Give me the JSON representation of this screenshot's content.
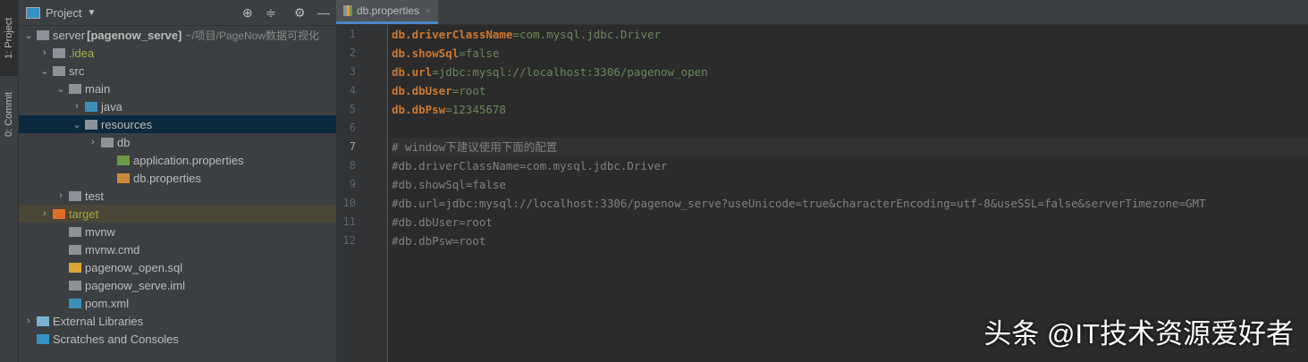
{
  "strip": {
    "tab1": "1: Project",
    "tab2": "0: Commit"
  },
  "panel": {
    "title": "Project"
  },
  "tree": [
    {
      "label": "server",
      "bold": "[pagenow_serve]",
      "hint": "~/项目/PageNow数据可视化",
      "depth": 0,
      "arrow": "⌄",
      "icon": "module",
      "color": "#bbbbbb"
    },
    {
      "label": ".idea",
      "depth": 1,
      "arrow": "›",
      "icon": "folder",
      "color": "#a7b14a"
    },
    {
      "label": "src",
      "depth": 1,
      "arrow": "⌄",
      "icon": "folder",
      "color": "#bbbbbb"
    },
    {
      "label": "main",
      "depth": 2,
      "arrow": "⌄",
      "icon": "folder",
      "color": "#bbbbbb"
    },
    {
      "label": "java",
      "depth": 3,
      "arrow": "›",
      "icon": "source-folder",
      "color": "#bbbbbb"
    },
    {
      "label": "resources",
      "depth": 3,
      "arrow": "⌄",
      "icon": "resources-folder",
      "color": "#bbbbbb",
      "selected": true
    },
    {
      "label": "db",
      "depth": 4,
      "arrow": "›",
      "icon": "folder",
      "color": "#bbbbbb"
    },
    {
      "label": "application.properties",
      "depth": 5,
      "arrow": "",
      "icon": "spring",
      "color": "#bbbbbb"
    },
    {
      "label": "db.properties",
      "depth": 5,
      "arrow": "",
      "icon": "properties",
      "color": "#bbbbbb"
    },
    {
      "label": "test",
      "depth": 2,
      "arrow": "›",
      "icon": "folder",
      "color": "#bbbbbb"
    },
    {
      "label": "target",
      "depth": 1,
      "arrow": "›",
      "icon": "excluded-folder",
      "color": "#a7a53a",
      "target": true
    },
    {
      "label": "mvnw",
      "depth": 2,
      "arrow": "",
      "icon": "shell",
      "color": "#bbbbbb"
    },
    {
      "label": "mvnw.cmd",
      "depth": 2,
      "arrow": "",
      "icon": "text",
      "color": "#bbbbbb"
    },
    {
      "label": "pagenow_open.sql",
      "depth": 2,
      "arrow": "",
      "icon": "sql",
      "color": "#bbbbbb"
    },
    {
      "label": "pagenow_serve.iml",
      "depth": 2,
      "arrow": "",
      "icon": "iml",
      "color": "#bbbbbb"
    },
    {
      "label": "pom.xml",
      "depth": 2,
      "arrow": "",
      "icon": "maven",
      "color": "#bbbbbb"
    },
    {
      "label": "External Libraries",
      "depth": 0,
      "arrow": "›",
      "icon": "libraries",
      "color": "#bbbbbb"
    },
    {
      "label": "Scratches and Consoles",
      "depth": 0,
      "arrow": "",
      "icon": "scratches",
      "color": "#bbbbbb"
    }
  ],
  "editor": {
    "tab": "db.properties",
    "close": "×"
  },
  "lines": [
    {
      "n": "1",
      "k": "db.driverClassName",
      "v": "com.mysql.jdbc.Driver"
    },
    {
      "n": "2",
      "k": "db.showSql",
      "v": "false"
    },
    {
      "n": "3",
      "k": "db.url",
      "v": "jdbc:mysql://localhost:3306/pagenow_open"
    },
    {
      "n": "4",
      "k": "db.dbUser",
      "v": "root"
    },
    {
      "n": "5",
      "k": "db.dbPsw",
      "v": "12345678"
    },
    {
      "n": "6",
      "c": ""
    },
    {
      "n": "7",
      "c": "# window下建议使用下面的配置"
    },
    {
      "n": "8",
      "c": "#db.driverClassName=com.mysql.jdbc.Driver"
    },
    {
      "n": "9",
      "c": "#db.showSql=false"
    },
    {
      "n": "10",
      "c": "#db.url=jdbc:mysql://localhost:3306/pagenow_serve?useUnicode=true&characterEncoding=utf-8&useSSL=false&serverTimezone=GMT"
    },
    {
      "n": "11",
      "c": "#db.dbUser=root"
    },
    {
      "n": "12",
      "c": "#db.dbPsw=root"
    }
  ],
  "watermark": "头条 @IT技术资源爱好者"
}
